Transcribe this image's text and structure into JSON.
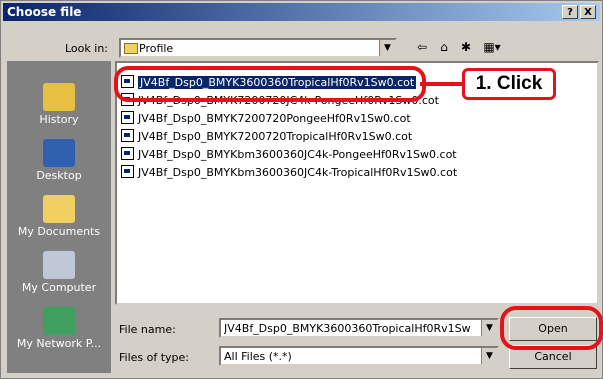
{
  "window": {
    "title": "Choose file",
    "help_btn": "?",
    "close_btn": "X"
  },
  "lookin": {
    "label": "Look in:",
    "value": "Profile"
  },
  "toolbar": {
    "back_icon": "back-arrow-icon",
    "up_icon": "up-folder-icon",
    "new_folder_icon": "new-folder-icon",
    "view_icon": "view-menu-icon"
  },
  "places": [
    {
      "label": "History",
      "icon": "history-icon"
    },
    {
      "label": "Desktop",
      "icon": "desktop-icon"
    },
    {
      "label": "My Documents",
      "icon": "my-documents-icon"
    },
    {
      "label": "My Computer",
      "icon": "my-computer-icon"
    },
    {
      "label": "My Network P...",
      "icon": "my-network-places-icon"
    }
  ],
  "files": [
    "JV4Bf_Dsp0_BMYK3600360TropicalHf0Rv1Sw0.cot",
    "JV4Bf_Dsp0_BMYK7200720JC4k-PongeeHf0Rv1Sw0.cot",
    "JV4Bf_Dsp0_BMYK7200720PongeeHf0Rv1Sw0.cot",
    "JV4Bf_Dsp0_BMYK7200720TropicalHf0Rv1Sw0.cot",
    "JV4Bf_Dsp0_BMYKbm3600360JC4k-PongeeHf0Rv1Sw0.cot",
    "JV4Bf_Dsp0_BMYKbm3600360JC4k-TropicalHf0Rv1Sw0.cot"
  ],
  "filename": {
    "label": "File name:",
    "value": "JV4Bf_Dsp0_BMYK3600360TropicalHf0Rv1Sw"
  },
  "filetype": {
    "label": "Files of type:",
    "value": "All Files (*.*)"
  },
  "buttons": {
    "open": "Open",
    "cancel": "Cancel"
  },
  "annotation": {
    "text": "1. Click",
    "color": "#e4131b"
  }
}
